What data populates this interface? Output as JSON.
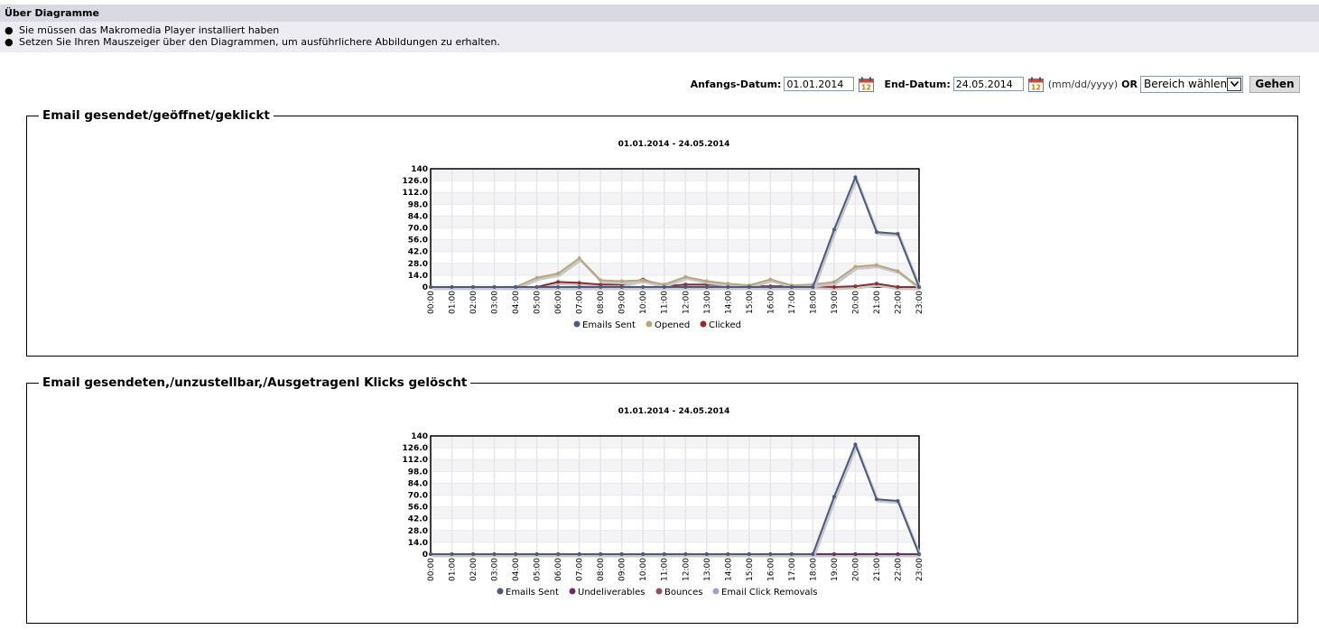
{
  "info": {
    "heading": "Über Diagramme",
    "bullets": [
      "Sie müssen das Makromedia Player installiert haben",
      "Setzen Sie Ihren Mauszeiger über den Diagrammen, um ausführlichere Abbildungen zu erhalten."
    ]
  },
  "datebar": {
    "start_label": "Anfangs-Datum:",
    "start_value": "01.01.2014",
    "end_label": "End-Datum:",
    "end_value": "24.05.2014",
    "format_hint": "(mm/dd/yyyy)",
    "or_label": "OR",
    "range_selected": "Bereich wählen",
    "go_label": "Gehen",
    "calendar_icon_text": "12"
  },
  "charts": [
    {
      "legend": "Email gesendet/geöffnet/geklickt",
      "chart_data": {
        "type": "line",
        "title": "01.01.2014 - 24.05.2014",
        "x": [
          "00:00",
          "01:00",
          "02:00",
          "03:00",
          "04:00",
          "05:00",
          "06:00",
          "07:00",
          "08:00",
          "09:00",
          "10:00",
          "11:00",
          "12:00",
          "13:00",
          "14:00",
          "15:00",
          "16:00",
          "17:00",
          "18:00",
          "19:00",
          "20:00",
          "21:00",
          "22:00",
          "23:00"
        ],
        "ylim": [
          0,
          140
        ],
        "yticks": [
          "0",
          "14.0",
          "28.0",
          "42.0",
          "56.0",
          "70.0",
          "84.0",
          "98.0",
          "112.0",
          "126.0",
          "140"
        ],
        "grid": true,
        "legend_position": "bottom",
        "series": [
          {
            "name": "Emails Sent",
            "color": "#4c5a82",
            "values": [
              0,
              0,
              0,
              0,
              0,
              0,
              0,
              0,
              0,
              0,
              0,
              0,
              0,
              0,
              0,
              0,
              0,
              0,
              0,
              68,
              130,
              65,
              63,
              0
            ]
          },
          {
            "name": "Opened",
            "color": "#b8a77e",
            "values": [
              0,
              0,
              0,
              0,
              0,
              11,
              16,
              34,
              8,
              7,
              8,
              3,
              12,
              7,
              4,
              2,
              9,
              2,
              3,
              6,
              24,
              26,
              19,
              0
            ]
          },
          {
            "name": "Clicked",
            "color": "#8b2f2f",
            "values": [
              0,
              0,
              0,
              0,
              0,
              0,
              6,
              5,
              3,
              3,
              9,
              1,
              3,
              3,
              2,
              1,
              1,
              1,
              1,
              0,
              1,
              4,
              0,
              0
            ]
          }
        ]
      }
    },
    {
      "legend": "Email gesendeten,/unzustellbar,/Ausgetragenl Klicks gelöscht",
      "chart_data": {
        "type": "line",
        "title": "01.01.2014 - 24.05.2014",
        "x": [
          "00:00",
          "01:00",
          "02:00",
          "03:00",
          "04:00",
          "05:00",
          "06:00",
          "07:00",
          "08:00",
          "09:00",
          "10:00",
          "11:00",
          "12:00",
          "13:00",
          "14:00",
          "15:00",
          "16:00",
          "17:00",
          "18:00",
          "19:00",
          "20:00",
          "21:00",
          "22:00",
          "23:00"
        ],
        "ylim": [
          0,
          140
        ],
        "yticks": [
          "0",
          "14.0",
          "28.0",
          "42.0",
          "56.0",
          "70.0",
          "84.0",
          "98.0",
          "112.0",
          "126.0",
          "140"
        ],
        "grid": true,
        "legend_position": "bottom",
        "series": [
          {
            "name": "Emails Sent",
            "color": "#4c5a82",
            "values": [
              0,
              0,
              0,
              0,
              0,
              0,
              0,
              0,
              0,
              0,
              0,
              0,
              0,
              0,
              0,
              0,
              0,
              0,
              0,
              68,
              130,
              65,
              63,
              0
            ]
          },
          {
            "name": "Undeliverables",
            "color": "#6b2e6b",
            "values": [
              0,
              0,
              0,
              0,
              0,
              0,
              0,
              0,
              0,
              0,
              0,
              0,
              0,
              0,
              0,
              0,
              0,
              0,
              0,
              0,
              0,
              0,
              0,
              0
            ]
          },
          {
            "name": "Bounces",
            "color": "#9a4a5e",
            "values": [
              0,
              0,
              0,
              0,
              0,
              0,
              0,
              0,
              0,
              0,
              0,
              0,
              0,
              0,
              0,
              0,
              0,
              0,
              0,
              0,
              0,
              0,
              0,
              0
            ]
          },
          {
            "name": "Email Click Removals",
            "color": "#93a6c7",
            "values": [
              0,
              0,
              0,
              0,
              0,
              0,
              0,
              0,
              0,
              0,
              0,
              0,
              0,
              0,
              0,
              0,
              0,
              0,
              0,
              0,
              0,
              0,
              0,
              0
            ]
          }
        ]
      }
    }
  ]
}
